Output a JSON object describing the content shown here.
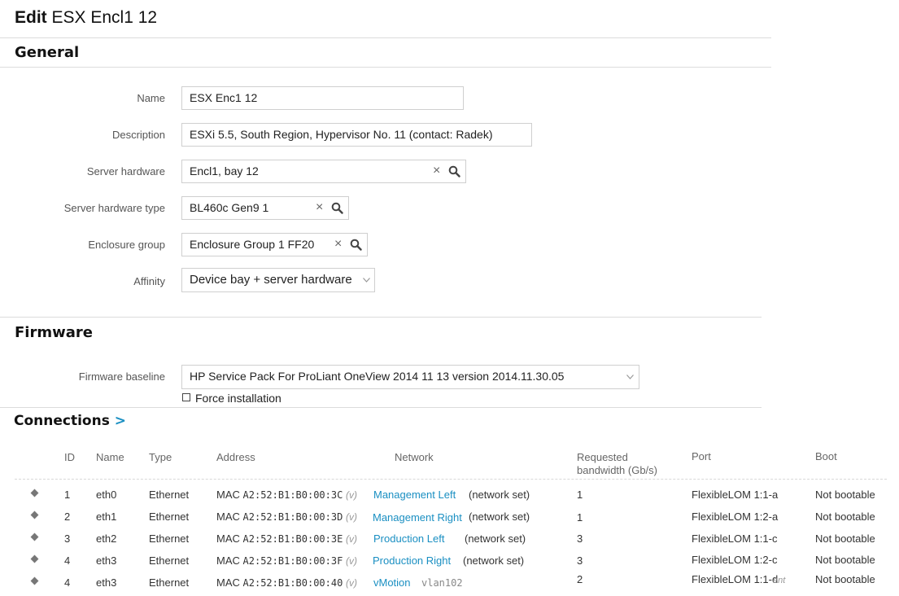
{
  "title": {
    "action": "Edit",
    "name": "ESX Encl1 12"
  },
  "general": {
    "heading": "General",
    "fields": {
      "name": {
        "label": "Name",
        "value": "ESX Enc1 12"
      },
      "description": {
        "label": "Description",
        "value": "ESXi 5.5, South Region, Hypervisor No. 11 (contact: Radek)"
      },
      "server_hardware": {
        "label": "Server hardware",
        "value": "Encl1, bay 12"
      },
      "server_hardware_type": {
        "label": "Server hardware type",
        "value": "BL460c Gen9 1"
      },
      "enclosure_group": {
        "label": "Enclosure group",
        "value": "Enclosure Group 1 FF20"
      },
      "affinity": {
        "label": "Affinity",
        "value": "Device bay + server hardware"
      }
    },
    "clear_glyph": "×"
  },
  "firmware": {
    "heading": "Firmware",
    "baseline_label": "Firmware baseline",
    "baseline_value": "HP Service Pack For ProLiant OneView 2014 11 13 version 2014.11.30.05",
    "force_label": "Force installation"
  },
  "connections": {
    "heading": "Connections",
    "arrow": ">",
    "columns": {
      "id": "ID",
      "name": "Name",
      "type": "Type",
      "address": "Address",
      "network": "Network",
      "bandwidth_line1": "Requested",
      "bandwidth_line2": "bandwidth (Gb/s)",
      "port": "Port",
      "boot": "Boot"
    },
    "rows": [
      {
        "id": "1",
        "name": "eth0",
        "type": "Ethernet",
        "mac_label": "MAC",
        "mac": "A2:52:B1:B0:00:3C",
        "v": "(v)",
        "network": "Management Left",
        "network_type": "(network set)",
        "bandwidth": "1",
        "port": "FlexibleLOM 1:1-a",
        "boot": "Not bootable"
      },
      {
        "id": "2",
        "name": "eth1",
        "type": "Ethernet",
        "mac_label": "MAC",
        "mac": "A2:52:B1:B0:00:3D",
        "v": "(v)",
        "network": "Management Right",
        "network_type": "(network set)",
        "bandwidth": "1",
        "port": "FlexibleLOM 1:2-a",
        "boot": "Not bootable"
      },
      {
        "id": "3",
        "name": "eth2",
        "type": "Ethernet",
        "mac_label": "MAC",
        "mac": "A2:52:B1:B0:00:3E",
        "v": "(v)",
        "network": "Production Left",
        "network_type": "(network set)",
        "bandwidth": "3",
        "port": "FlexibleLOM 1:1-c",
        "boot": "Not bootable"
      },
      {
        "id": "4",
        "name": "eth3",
        "type": "Ethernet",
        "mac_label": "MAC",
        "mac": "A2:52:B1:B0:00:3F",
        "v": "(v)",
        "network": "Production Right",
        "network_type": "(network set)",
        "bandwidth": "3",
        "port": "FlexibleLOM 1:2-c",
        "boot": "Not bootable"
      },
      {
        "id": "4",
        "name": "eth3",
        "type": "Ethernet",
        "mac_label": "MAC",
        "mac": "A2:52:B1:B0:00:40",
        "v": "(v)",
        "network": "vMotion",
        "network_type": "vlan102",
        "bandwidth": "2",
        "port": "FlexibleLOM 1:1-d",
        "port_suffix": "ent",
        "boot": "Not bootable"
      }
    ]
  },
  "colors": {
    "link": "#1a8fc2",
    "accent_arrow": "#1a8fc2",
    "border": "#cfcfcf"
  },
  "icons": {
    "search": "search-icon",
    "clear": "clear-icon",
    "caret": "chevron-down-icon",
    "row_marker": "drag-handle-icon"
  }
}
